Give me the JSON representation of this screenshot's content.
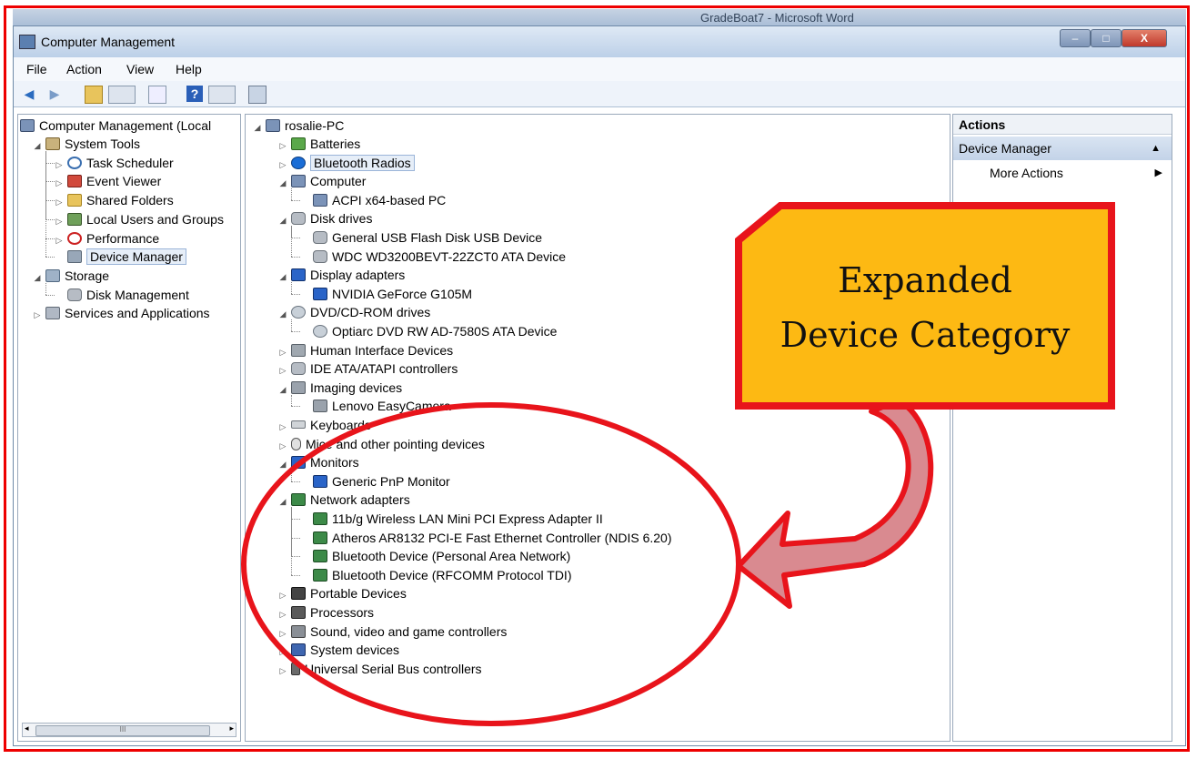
{
  "background_app": {
    "title_fragment": "GradeBoat7 - Microsoft Word"
  },
  "window": {
    "title": "Computer Management",
    "controls": {
      "minimize": "–",
      "maximize": "□",
      "close": "X"
    }
  },
  "menu": [
    "File",
    "Action",
    "View",
    "Help"
  ],
  "toolbar_icons": [
    "back-arrow-icon",
    "forward-arrow-icon",
    "up-folder-icon",
    "console-tree-icon",
    "properties-icon",
    "help-icon",
    "show-hide-icon",
    "device-scan-icon"
  ],
  "left_tree": {
    "root": "Computer Management (Local",
    "items": [
      {
        "label": "System Tools",
        "level": 1,
        "expander": "◢",
        "icon": "tools-icon"
      },
      {
        "label": "Task Scheduler",
        "level": 2,
        "expander": "▷",
        "icon": "clock-icon"
      },
      {
        "label": "Event Viewer",
        "level": 2,
        "expander": "▷",
        "icon": "event-viewer-icon"
      },
      {
        "label": "Shared Folders",
        "level": 2,
        "expander": "▷",
        "icon": "shared-folder-icon"
      },
      {
        "label": "Local Users and Groups",
        "level": 2,
        "expander": "▷",
        "icon": "users-icon"
      },
      {
        "label": "Performance",
        "level": 2,
        "expander": "▷",
        "icon": "performance-icon"
      },
      {
        "label": "Device Manager",
        "level": 2,
        "expander": "",
        "icon": "device-manager-icon",
        "selected": true
      },
      {
        "label": "Storage",
        "level": 1,
        "expander": "◢",
        "icon": "storage-icon"
      },
      {
        "label": "Disk Management",
        "level": 2,
        "expander": "",
        "icon": "disk-icon"
      },
      {
        "label": "Services and Applications",
        "level": 1,
        "expander": "▷",
        "icon": "services-icon"
      }
    ],
    "scroll_thumb": "III"
  },
  "device_tree": {
    "root": "rosalie-PC",
    "items": [
      {
        "label": "Batteries",
        "level": 1,
        "expander": "▷",
        "icon": "battery-icon"
      },
      {
        "label": "Bluetooth Radios",
        "level": 1,
        "expander": "▷",
        "icon": "bluetooth-icon",
        "selected": true
      },
      {
        "label": "Computer",
        "level": 1,
        "expander": "◢",
        "icon": "computer-icon"
      },
      {
        "label": "ACPI x64-based PC",
        "level": 2,
        "icon": "computer-icon"
      },
      {
        "label": "Disk drives",
        "level": 1,
        "expander": "◢",
        "icon": "disk-drive-icon"
      },
      {
        "label": "General USB Flash Disk USB Device",
        "level": 2,
        "icon": "disk-drive-icon"
      },
      {
        "label": "WDC WD3200BEVT-22ZCT0 ATA Device",
        "level": 2,
        "icon": "disk-drive-icon"
      },
      {
        "label": "Display adapters",
        "level": 1,
        "expander": "◢",
        "icon": "display-adapter-icon"
      },
      {
        "label": "NVIDIA GeForce G105M",
        "level": 2,
        "icon": "display-adapter-icon"
      },
      {
        "label": "DVD/CD-ROM drives",
        "level": 1,
        "expander": "◢",
        "icon": "dvd-drive-icon"
      },
      {
        "label": "Optiarc DVD RW AD-7580S ATA Device",
        "level": 2,
        "icon": "dvd-drive-icon"
      },
      {
        "label": "Human Interface Devices",
        "level": 1,
        "expander": "▷",
        "icon": "hid-icon"
      },
      {
        "label": "IDE ATA/ATAPI controllers",
        "level": 1,
        "expander": "▷",
        "icon": "ide-controller-icon"
      },
      {
        "label": "Imaging devices",
        "level": 1,
        "expander": "◢",
        "icon": "camera-icon"
      },
      {
        "label": "Lenovo EasyCamera",
        "level": 2,
        "icon": "camera-icon"
      },
      {
        "label": "Keyboards",
        "level": 1,
        "expander": "▷",
        "icon": "keyboard-icon"
      },
      {
        "label": "Mice and other pointing devices",
        "level": 1,
        "expander": "▷",
        "icon": "mouse-icon"
      },
      {
        "label": "Monitors",
        "level": 1,
        "expander": "◢",
        "icon": "monitor-icon"
      },
      {
        "label": "Generic PnP Monitor",
        "level": 2,
        "icon": "monitor-icon"
      },
      {
        "label": "Network adapters",
        "level": 1,
        "expander": "◢",
        "icon": "network-adapter-icon"
      },
      {
        "label": "11b/g Wireless LAN Mini PCI Express Adapter II",
        "level": 2,
        "icon": "network-adapter-icon"
      },
      {
        "label": "Atheros AR8132 PCI-E Fast Ethernet Controller (NDIS 6.20)",
        "level": 2,
        "icon": "network-adapter-icon"
      },
      {
        "label": "Bluetooth Device (Personal Area Network)",
        "level": 2,
        "icon": "network-adapter-icon"
      },
      {
        "label": "Bluetooth Device (RFCOMM Protocol TDI)",
        "level": 2,
        "icon": "network-adapter-icon"
      },
      {
        "label": "Portable Devices",
        "level": 1,
        "expander": "▷",
        "icon": "portable-device-icon"
      },
      {
        "label": "Processors",
        "level": 1,
        "expander": "▷",
        "icon": "processor-icon"
      },
      {
        "label": "Sound, video and game controllers",
        "level": 1,
        "expander": "▷",
        "icon": "sound-icon"
      },
      {
        "label": "System devices",
        "level": 1,
        "expander": "▷",
        "icon": "system-device-icon"
      },
      {
        "label": "Universal Serial Bus controllers",
        "level": 1,
        "expander": "▷",
        "icon": "usb-icon"
      }
    ]
  },
  "actions_pane": {
    "header": "Actions",
    "section": "Device Manager",
    "section_arrow": "▲",
    "items": [
      {
        "label": "More Actions",
        "arrow": "▶"
      }
    ]
  },
  "annotation": {
    "callout_line1": "Expanded",
    "callout_line2": "Device Category",
    "callout_fill": "#FDB913",
    "outline_color": "#E8141B",
    "arrow_fill": "#D98A90"
  },
  "colors": {
    "frame_red": "#E00000",
    "titlebar": "#BCD0E8",
    "selection": "#E6EEF8"
  }
}
